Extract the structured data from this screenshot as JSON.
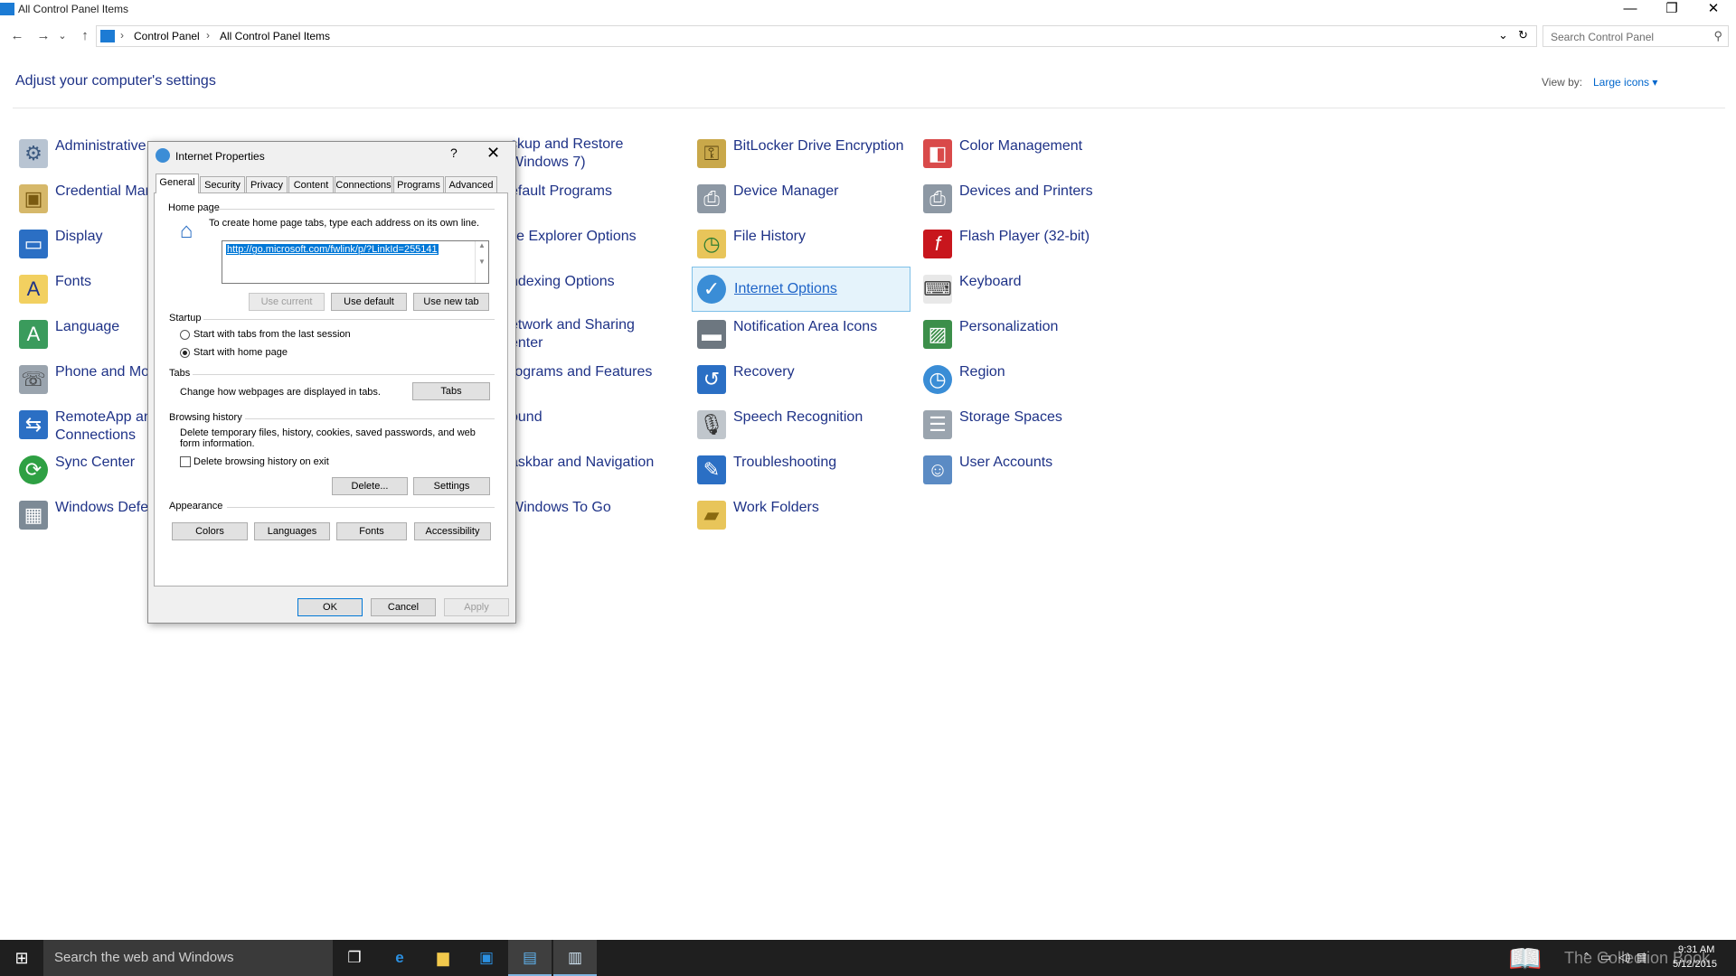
{
  "window": {
    "title": "All Control Panel Items",
    "minimize": "—",
    "restore": "❐",
    "close": "✕"
  },
  "nav": {
    "back": "←",
    "forward": "→",
    "recent": "⌄",
    "up": "↑",
    "breadcrumb": [
      "Control Panel",
      "All Control Panel Items"
    ],
    "refresh": "↻",
    "dropdown": "⌄",
    "search_placeholder": "Search Control Panel",
    "search_icon": "⚲"
  },
  "header": {
    "title": "Adjust your computer's settings",
    "view_by_label": "View by:",
    "view_by_value": "Large icons ▾"
  },
  "items": {
    "col1": [
      "Administrative",
      "Credential Mar",
      "Display",
      "Fonts",
      "Language",
      "Phone and Mo",
      "RemoteApp an",
      "Connections",
      "Sync Center",
      "Windows Defe"
    ],
    "col2": [
      "ckup and Restore",
      "Windows 7)",
      "efault Programs",
      "ile Explorer Options",
      "ndexing Options",
      "etwork and Sharing",
      "enter",
      "rograms and Features",
      "ound",
      "askbar and Navigation",
      "Windows To Go"
    ],
    "col3": [
      "BitLocker Drive Encryption",
      "Device Manager",
      "File History",
      "Internet Options",
      "Notification Area Icons",
      "Recovery",
      "Speech Recognition",
      "Troubleshooting",
      "Work Folders"
    ],
    "col4": [
      "Color Management",
      "Devices and Printers",
      "Flash Player (32-bit)",
      "Keyboard",
      "Personalization",
      "Region",
      "Storage Spaces",
      "User Accounts"
    ]
  },
  "icons": {
    "admin": "gear-icon",
    "credential": "vault-icon",
    "display": "monitor-icon",
    "fonts": "font-icon",
    "language": "globe-icon",
    "phone": "modem-icon",
    "remoteapp": "remote-icon",
    "sync": "sync-icon",
    "defender": "wall-icon",
    "bitlocker": "key-icon",
    "device_manager": "printer-icon",
    "file_history": "folder-clock-icon",
    "internet": "globe-check-icon",
    "notification": "taskbar-icon",
    "recovery": "recovery-icon",
    "speech": "mic-icon",
    "troubleshoot": "wrench-icon",
    "work_folders": "folder-icon",
    "color": "color-icon",
    "devices": "devices-icon",
    "flash": "flash-icon",
    "keyboard": "keyboard-icon",
    "personalization": "paint-icon",
    "region": "clock-globe-icon",
    "storage": "storage-icon",
    "users": "users-icon"
  },
  "dialog": {
    "title": "Internet Properties",
    "help": "?",
    "close": "✕",
    "tabs": [
      "General",
      "Security",
      "Privacy",
      "Content",
      "Connections",
      "Programs",
      "Advanced"
    ],
    "home_page": {
      "label": "Home page",
      "hint": "To create home page tabs, type each address on its own line.",
      "url": "http://go.microsoft.com/fwlink/p/?LinkId=255141",
      "use_current": "Use current",
      "use_default": "Use default",
      "use_new_tab": "Use new tab"
    },
    "startup": {
      "label": "Startup",
      "option1": "Start with tabs from the last session",
      "option2": "Start with home page",
      "selected": "Start with home page"
    },
    "tabs_group": {
      "label": "Tabs",
      "text": "Change how webpages are displayed in tabs.",
      "button": "Tabs"
    },
    "history": {
      "label": "Browsing history",
      "text1": "Delete temporary files, history, cookies, saved passwords, and web",
      "text2": "form information.",
      "checkbox": "Delete browsing history on exit",
      "checked": false,
      "delete": "Delete...",
      "settings": "Settings"
    },
    "appearance": {
      "label": "Appearance",
      "colors": "Colors",
      "languages": "Languages",
      "fonts": "Fonts",
      "accessibility": "Accessibility"
    },
    "ok": "OK",
    "cancel": "Cancel",
    "apply": "Apply"
  },
  "taskbar": {
    "start": "⊞",
    "search": "Search the web and Windows",
    "task_view": "❐",
    "ie": "e",
    "explorer": "▆",
    "store": "▣",
    "control_panel": "▤",
    "internet_props": "▥",
    "watermark": "The Collection Book",
    "time": "9:31 AM",
    "date": "5/12/2015"
  }
}
